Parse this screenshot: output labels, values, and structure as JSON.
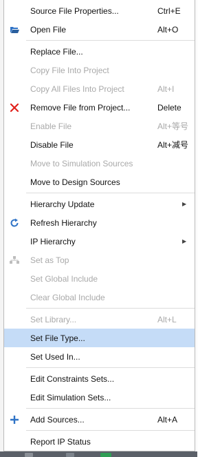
{
  "menu": {
    "items": [
      {
        "label": "Source File Properties...",
        "shortcut": "Ctrl+E",
        "enabled": true,
        "icon": ""
      },
      {
        "label": "Open File",
        "shortcut": "Alt+O",
        "enabled": true,
        "icon": "folder-open-icon"
      },
      {
        "label": "Replace File...",
        "shortcut": "",
        "enabled": true,
        "icon": ""
      },
      {
        "label": "Copy File Into Project",
        "shortcut": "",
        "enabled": false,
        "icon": ""
      },
      {
        "label": "Copy All Files Into Project",
        "shortcut": "Alt+I",
        "enabled": false,
        "icon": ""
      },
      {
        "label": "Remove File from Project...",
        "shortcut": "Delete",
        "enabled": true,
        "icon": "remove-x-icon"
      },
      {
        "label": "Enable File",
        "shortcut": "Alt+等号",
        "enabled": false,
        "icon": ""
      },
      {
        "label": "Disable File",
        "shortcut": "Alt+减号",
        "enabled": true,
        "icon": ""
      },
      {
        "label": "Move to Simulation Sources",
        "shortcut": "",
        "enabled": false,
        "icon": ""
      },
      {
        "label": "Move to Design Sources",
        "shortcut": "",
        "enabled": true,
        "icon": ""
      },
      {
        "label": "Hierarchy Update",
        "shortcut": "",
        "enabled": true,
        "icon": "",
        "submenu": true
      },
      {
        "label": "Refresh Hierarchy",
        "shortcut": "",
        "enabled": true,
        "icon": "refresh-icon"
      },
      {
        "label": "IP Hierarchy",
        "shortcut": "",
        "enabled": true,
        "icon": "",
        "submenu": true
      },
      {
        "label": "Set as Top",
        "shortcut": "",
        "enabled": false,
        "icon": "hierarchy-icon"
      },
      {
        "label": "Set Global Include",
        "shortcut": "",
        "enabled": false,
        "icon": ""
      },
      {
        "label": "Clear Global Include",
        "shortcut": "",
        "enabled": false,
        "icon": ""
      },
      {
        "label": "Set Library...",
        "shortcut": "Alt+L",
        "enabled": false,
        "icon": ""
      },
      {
        "label": "Set File Type...",
        "shortcut": "",
        "enabled": true,
        "icon": "",
        "selected": true
      },
      {
        "label": "Set Used In...",
        "shortcut": "",
        "enabled": true,
        "icon": ""
      },
      {
        "label": "Edit Constraints Sets...",
        "shortcut": "",
        "enabled": true,
        "icon": ""
      },
      {
        "label": "Edit Simulation Sets...",
        "shortcut": "",
        "enabled": true,
        "icon": ""
      },
      {
        "label": "Add Sources...",
        "shortcut": "Alt+A",
        "enabled": true,
        "icon": "plus-icon"
      },
      {
        "label": "Report IP Status",
        "shortcut": "",
        "enabled": true,
        "icon": ""
      }
    ]
  },
  "colors": {
    "selected_bg": "#c5dcf7",
    "disabled_text": "#a9a9a9",
    "remove_icon": "#e0201b",
    "blue_icon": "#2f73c6"
  }
}
